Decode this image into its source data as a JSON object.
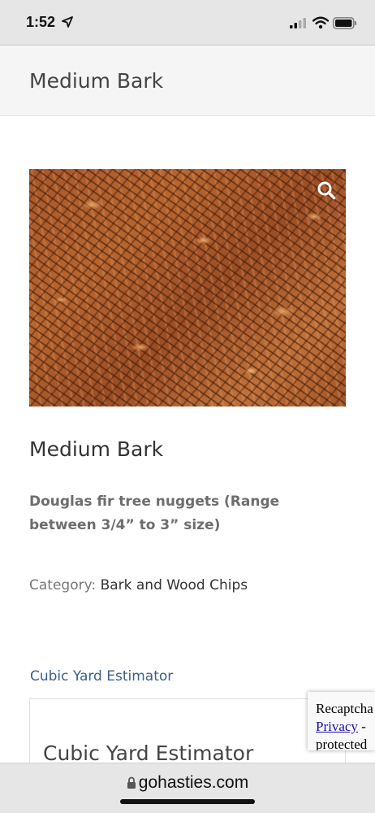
{
  "status_bar": {
    "time": "1:52"
  },
  "header": {
    "site_title": "Medium Bark"
  },
  "product": {
    "title": "Medium Bark",
    "description": "Douglas fir tree nuggets (Range between 3/4” to 3” size)",
    "category_label": "Category:",
    "category_value": "Bark and Wood Chips"
  },
  "estimator": {
    "link_text": "Cubic Yard Estimator",
    "box_title": "Cubic Yard Estimator"
  },
  "recaptcha": {
    "line1": "Recaptcha",
    "privacy": "Privacy",
    "sep": " - ",
    "line3": "protected"
  },
  "browser": {
    "url": "gohasties.com"
  },
  "icons": {
    "location": "location-arrow-icon",
    "signal": "cellular-signal-icon",
    "wifi": "wifi-icon",
    "battery": "battery-icon",
    "zoom": "search-icon",
    "lock": "lock-icon"
  }
}
